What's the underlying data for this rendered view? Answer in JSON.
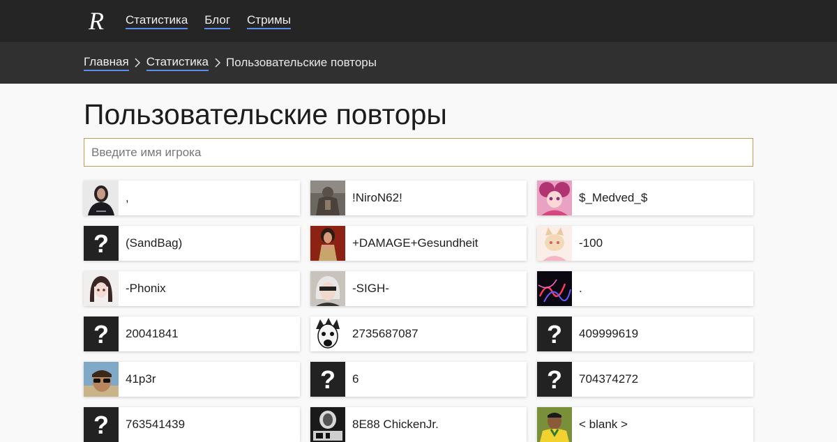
{
  "nav": {
    "logo_letter": "R",
    "items": [
      "Статистика",
      "Блог",
      "Стримы"
    ]
  },
  "breadcrumb": {
    "home": "Главная",
    "stats": "Статистика",
    "current": "Пользовательские повторы"
  },
  "page_title": "Пользовательские повторы",
  "search": {
    "placeholder": "Введите имя игрока",
    "value": ""
  },
  "colors": {
    "link_underline": "#5b8def",
    "search_border": "#b8a04f",
    "topbar": "#252525",
    "crumbbar": "#303030"
  },
  "players": [
    {
      "name": ",",
      "avatar": "woman-portrait"
    },
    {
      "name": "!NiroN62!",
      "avatar": "armored-warrior"
    },
    {
      "name": "$_Medved_$",
      "avatar": "anime-pink-girl"
    },
    {
      "name": "(SandBag)",
      "avatar": "unknown"
    },
    {
      "name": "+DAMAGE+Gesundheit",
      "avatar": "fighter-woman"
    },
    {
      "name": "-100",
      "avatar": "anime-fox-girl"
    },
    {
      "name": "-Phonix",
      "avatar": "anime-dark-hair-girl"
    },
    {
      "name": "-SIGH-",
      "avatar": "white-hair-android"
    },
    {
      "name": ".",
      "avatar": "neon-light-art"
    },
    {
      "name": "20041841",
      "avatar": "unknown"
    },
    {
      "name": "2735687087",
      "avatar": "manga-screaming-face"
    },
    {
      "name": "409999619",
      "avatar": "unknown"
    },
    {
      "name": "41p3r",
      "avatar": "man-sunglasses"
    },
    {
      "name": "6",
      "avatar": "unknown"
    },
    {
      "name": "704374272",
      "avatar": "unknown"
    },
    {
      "name": "763541439",
      "avatar": "unknown"
    },
    {
      "name": "8E88 ChickenJr.",
      "avatar": "dark-poster"
    },
    {
      "name": "< blank >",
      "avatar": "football-player"
    }
  ]
}
